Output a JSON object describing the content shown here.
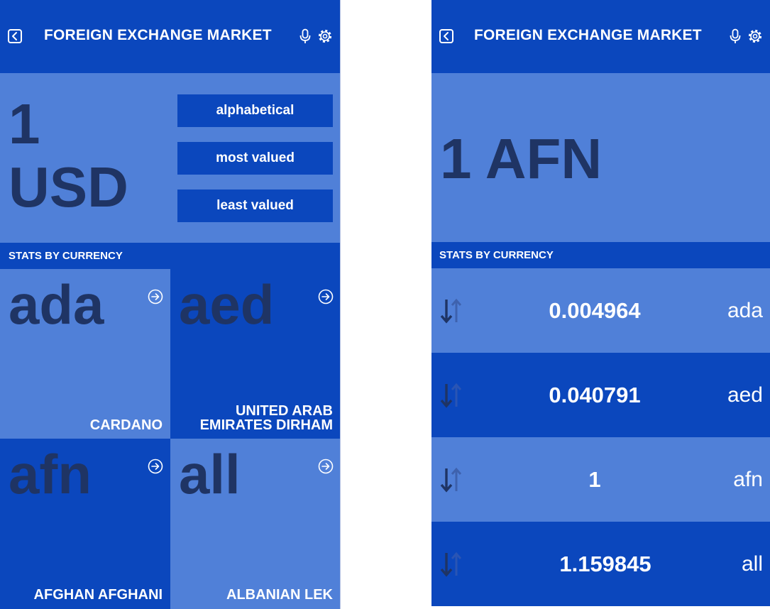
{
  "app": {
    "title": "FOREIGN EXCHANGE MARKET"
  },
  "colors": {
    "dark_blue": "#0b47bd",
    "light_blue": "#5080d8",
    "text_navy": "#1f3464",
    "white": "#ffffff"
  },
  "icons": {
    "back": "back-arrow-icon",
    "microphone": "microphone-icon",
    "settings": "gear-icon",
    "tile_link": "circled-arrow-right-icon",
    "sort_rate": "sort-arrows-icon"
  },
  "left_screen": {
    "base_amount": "1",
    "base_code": "USD",
    "sort_buttons": {
      "alphabetical": "alphabetical",
      "most_valued": "most valued",
      "least_valued": "least valued"
    },
    "stats_label": "STATS BY CURRENCY",
    "currencies": [
      {
        "code": "ada",
        "name": "CARDANO"
      },
      {
        "code": "aed",
        "name": "UNITED ARAB EMIRATES DIRHAM"
      },
      {
        "code": "afn",
        "name": "AFGHAN AFGHANI"
      },
      {
        "code": "all",
        "name": "ALBANIAN LEK"
      }
    ]
  },
  "right_screen": {
    "base_label": "1 AFN",
    "stats_label": "STATS BY CURRENCY",
    "rates": [
      {
        "rate": "0.004964",
        "code": "ada"
      },
      {
        "rate": "0.040791",
        "code": "aed"
      },
      {
        "rate": "1",
        "code": "afn"
      },
      {
        "rate": "1.159845",
        "code": "all"
      }
    ]
  }
}
